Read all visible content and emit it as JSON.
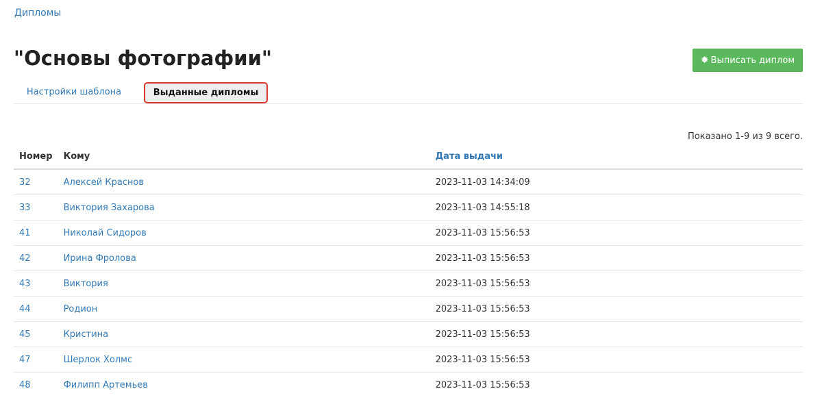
{
  "breadcrumb": {
    "label": "Дипломы"
  },
  "page": {
    "title": "\"Основы фотографии\""
  },
  "actions": {
    "issue_label": "Выписать диплом",
    "issue_icon": "certificate-icon"
  },
  "tabs": [
    {
      "label": "Настройки шаблона",
      "active": false
    },
    {
      "label": "Выданные дипломы",
      "active": true
    }
  ],
  "summary": "Показано 1-9 из 9 всего.",
  "table": {
    "columns": [
      "Номер",
      "Кому",
      "Дата выдачи"
    ],
    "rows": [
      {
        "number": "32",
        "to": "Алексей Краснов",
        "date": "2023-11-03 14:34:09"
      },
      {
        "number": "33",
        "to": "Виктория Захарова",
        "date": "2023-11-03 14:55:18"
      },
      {
        "number": "41",
        "to": "Николай Сидоров",
        "date": "2023-11-03 15:56:53"
      },
      {
        "number": "42",
        "to": "Ирина Фролова",
        "date": "2023-11-03 15:56:53"
      },
      {
        "number": "43",
        "to": "Виктория",
        "date": "2023-11-03 15:56:53"
      },
      {
        "number": "44",
        "to": "Родион",
        "date": "2023-11-03 15:56:53"
      },
      {
        "number": "45",
        "to": "Кристина",
        "date": "2023-11-03 15:56:53"
      },
      {
        "number": "47",
        "to": "Шерлок Холмс",
        "date": "2023-11-03 15:56:53"
      },
      {
        "number": "48",
        "to": "Филипп Артемьев",
        "date": "2023-11-03 15:56:53"
      }
    ]
  },
  "colors": {
    "link": "#337ab7",
    "button_success": "#5cb85c",
    "highlight_border": "#d9372f"
  }
}
